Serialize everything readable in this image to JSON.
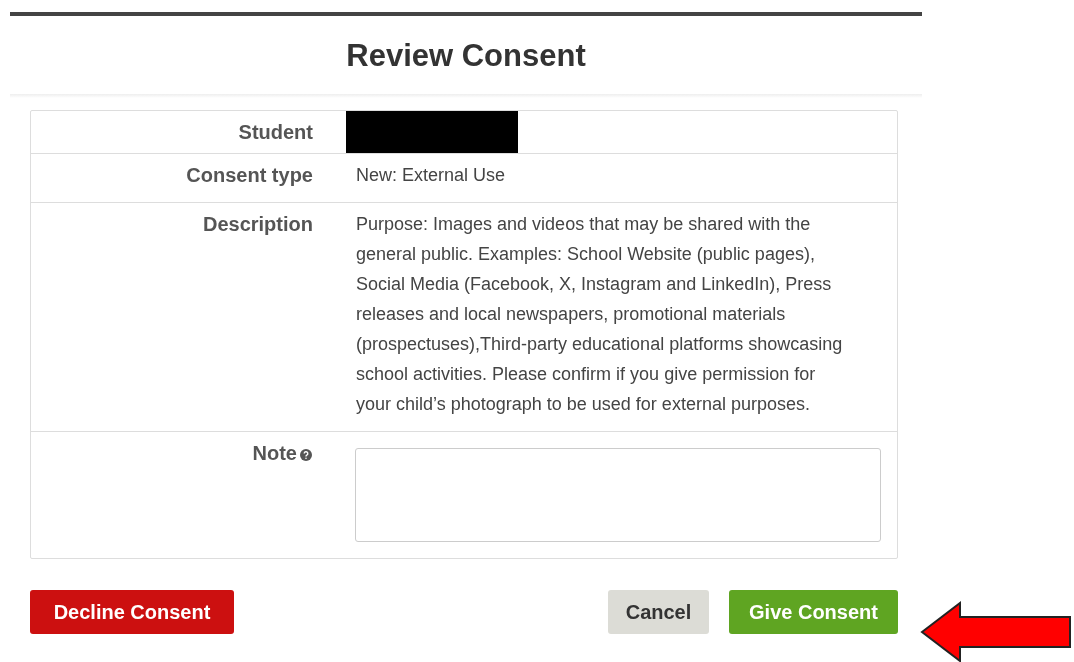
{
  "title": "Review Consent",
  "fields": [
    {
      "label": "Student",
      "kind": "redacted"
    },
    {
      "label": "Consent type",
      "kind": "text",
      "value": "New: External Use"
    },
    {
      "label": "Description",
      "kind": "text",
      "value": "Purpose: Images and videos that may be shared with the general public. Examples: School Website (public pages), Social Media (Facebook, X, Instagram and LinkedIn), Press releases and local newspapers, promotional materials (prospectuses),Third-party educational platforms showcasing school activities. Please confirm if you give permission for your child’s photograph to be used for external purposes."
    },
    {
      "label": "Note",
      "kind": "textarea",
      "help": true
    }
  ],
  "buttons": [
    {
      "label": "Decline Consent",
      "kind": "danger"
    },
    {
      "label": "Cancel",
      "kind": "default"
    },
    {
      "label": "Give Consent",
      "kind": "primary"
    }
  ]
}
